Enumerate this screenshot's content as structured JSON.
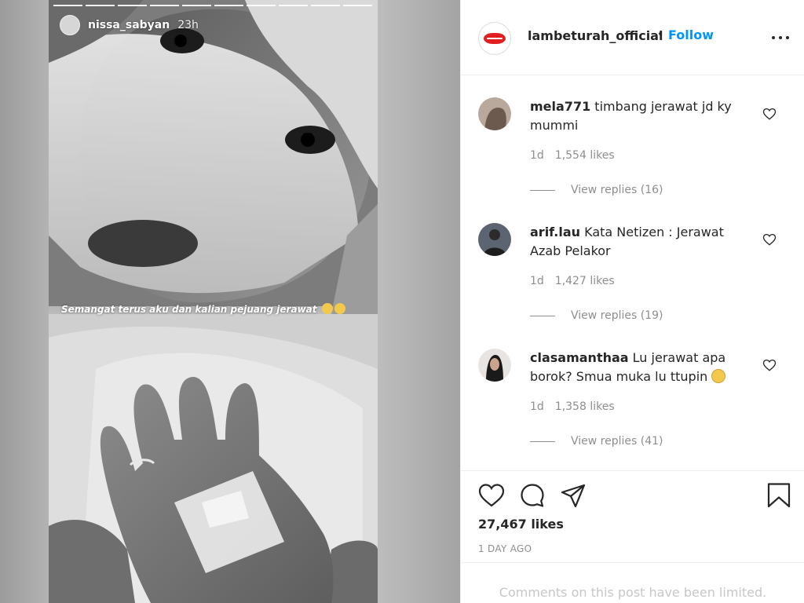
{
  "story": {
    "username": "nissa_sabyan",
    "time": "23h",
    "caption": "Semangat terus aku dan kalian pejuang jerawat",
    "progress_segments": 10
  },
  "post": {
    "account": "lambeturah_official",
    "separator": "•",
    "follow_label": "Follow",
    "more_icon": "more-horizontal-icon",
    "likes": "27,467 likes",
    "time": "1 DAY AGO",
    "comments_limited": "Comments on this post have been limited."
  },
  "comments": [
    {
      "user": "mela771",
      "text": "timbang jerawat jd ky mummi",
      "age": "1d",
      "likes": "1,554 likes",
      "replies": "View replies (16)"
    },
    {
      "user": "arif.lau",
      "text": "Kata Netizen : Jerawat Azab Pelakor",
      "age": "1d",
      "likes": "1,427 likes",
      "replies": "View replies (19)"
    },
    {
      "user": "clasamanthaa",
      "text": "Lu jerawat apa borok? Smua muka lu ttupin",
      "age": "1d",
      "likes": "1,358 likes",
      "replies": "View replies (41)",
      "emoji": "grimace-emoji"
    }
  ],
  "actions": [
    "heart-icon",
    "comment-icon",
    "share-icon",
    "bookmark-icon"
  ],
  "colors": {
    "link": "#0095f6",
    "text": "#262626",
    "muted": "#8e8e8e",
    "border": "#efefef",
    "brand_red": "#e02020"
  }
}
